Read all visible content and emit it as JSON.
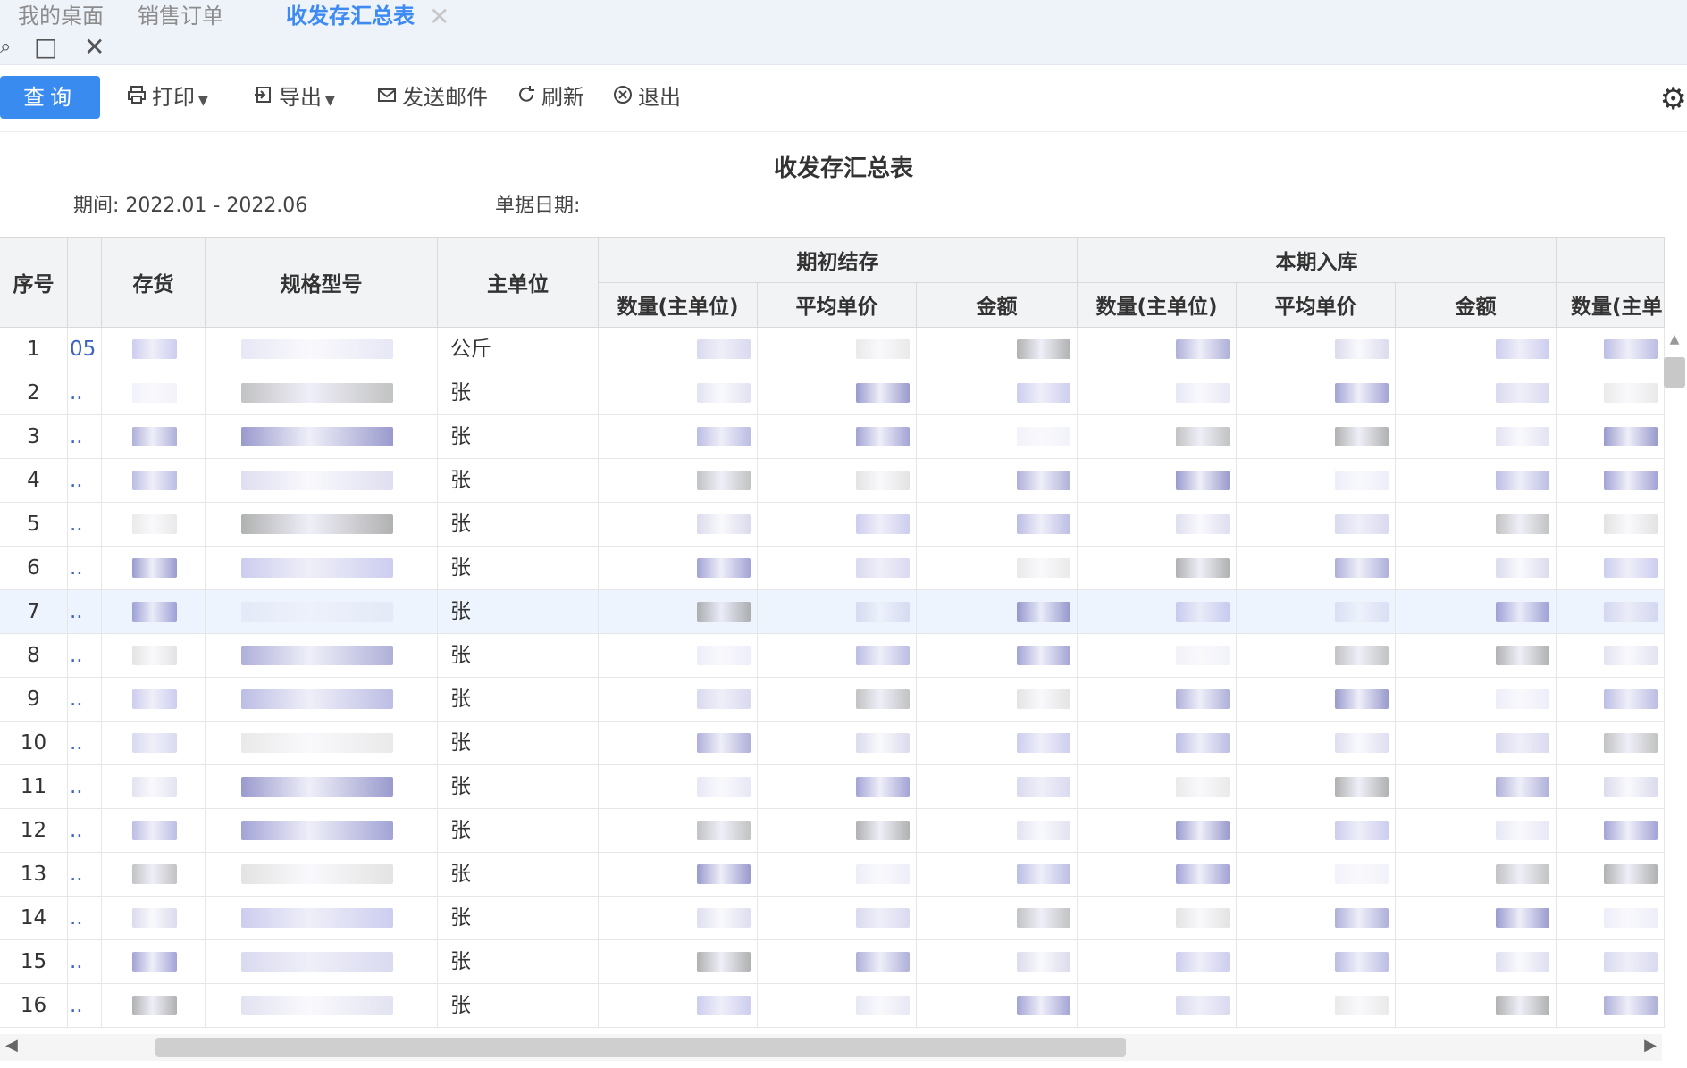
{
  "tabs": {
    "desktop": "我的桌面",
    "sales_order": "销售订单",
    "summary": "收发存汇总表",
    "close": "✕"
  },
  "window": {
    "restore_icon": "□",
    "close_icon": "✕"
  },
  "toolbar": {
    "query": "查询",
    "print": "打印",
    "export": "导出",
    "send_mail": "发送邮件",
    "refresh": "刷新",
    "exit": "退出",
    "settings_icon": "gear-icon"
  },
  "report": {
    "title": "收发存汇总表",
    "period_label": "期间:",
    "period_value": "2022.01 - 2022.06",
    "doc_date_label": "单据日期:"
  },
  "table": {
    "headers": {
      "seq": "序号",
      "inventory": "存货",
      "spec": "规格型号",
      "unit": "主单位",
      "opening_group": "期初结存",
      "receipt_group": "本期入库",
      "qty": "数量(主单位)",
      "avg_price": "平均单价",
      "amount": "金额",
      "qty_cut": "数量(主单"
    },
    "rows": [
      {
        "seq": "1",
        "code": "05",
        "unit": "公斤"
      },
      {
        "seq": "2",
        "code": "..",
        "unit": "张"
      },
      {
        "seq": "3",
        "code": "..",
        "unit": "张"
      },
      {
        "seq": "4",
        "code": "..",
        "unit": "张"
      },
      {
        "seq": "5",
        "code": "..",
        "unit": "张"
      },
      {
        "seq": "6",
        "code": "..",
        "unit": "张"
      },
      {
        "seq": "7",
        "code": "..",
        "unit": "张"
      },
      {
        "seq": "8",
        "code": "..",
        "unit": "张"
      },
      {
        "seq": "9",
        "code": "..",
        "unit": "张"
      },
      {
        "seq": "10",
        "code": "..",
        "unit": "张"
      },
      {
        "seq": "11",
        "code": "..",
        "unit": "张"
      },
      {
        "seq": "12",
        "code": "..",
        "unit": "张"
      },
      {
        "seq": "13",
        "code": "..",
        "unit": "张"
      },
      {
        "seq": "14",
        "code": "..",
        "unit": "张"
      },
      {
        "seq": "15",
        "code": "..",
        "unit": "张"
      },
      {
        "seq": "16",
        "code": "..",
        "unit": "张"
      }
    ],
    "selected_row": "7"
  },
  "scroll": {
    "up": "▲",
    "left": "◀",
    "right": "▶"
  }
}
